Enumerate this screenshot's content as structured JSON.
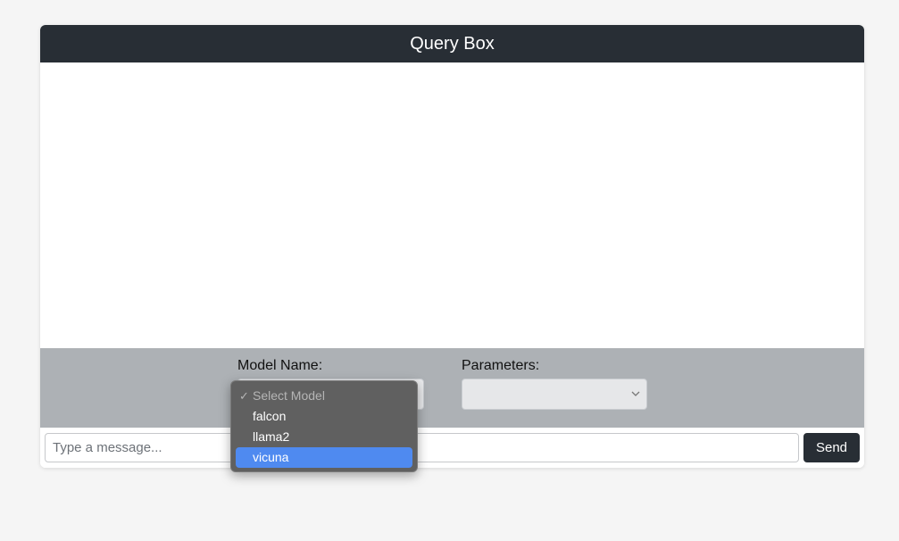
{
  "header": {
    "title": "Query Box"
  },
  "controls": {
    "model_label": "Model Name:",
    "parameters_label": "Parameters:",
    "model_dropdown": {
      "placeholder_option": "Select Model",
      "options": [
        "falcon",
        "llama2",
        "vicuna"
      ],
      "highlighted": "vicuna"
    }
  },
  "input": {
    "placeholder": "Type a message..."
  },
  "send_button": {
    "label": "Send"
  },
  "icons": {
    "check": "✓",
    "chevron": "chevron-down-icon"
  }
}
